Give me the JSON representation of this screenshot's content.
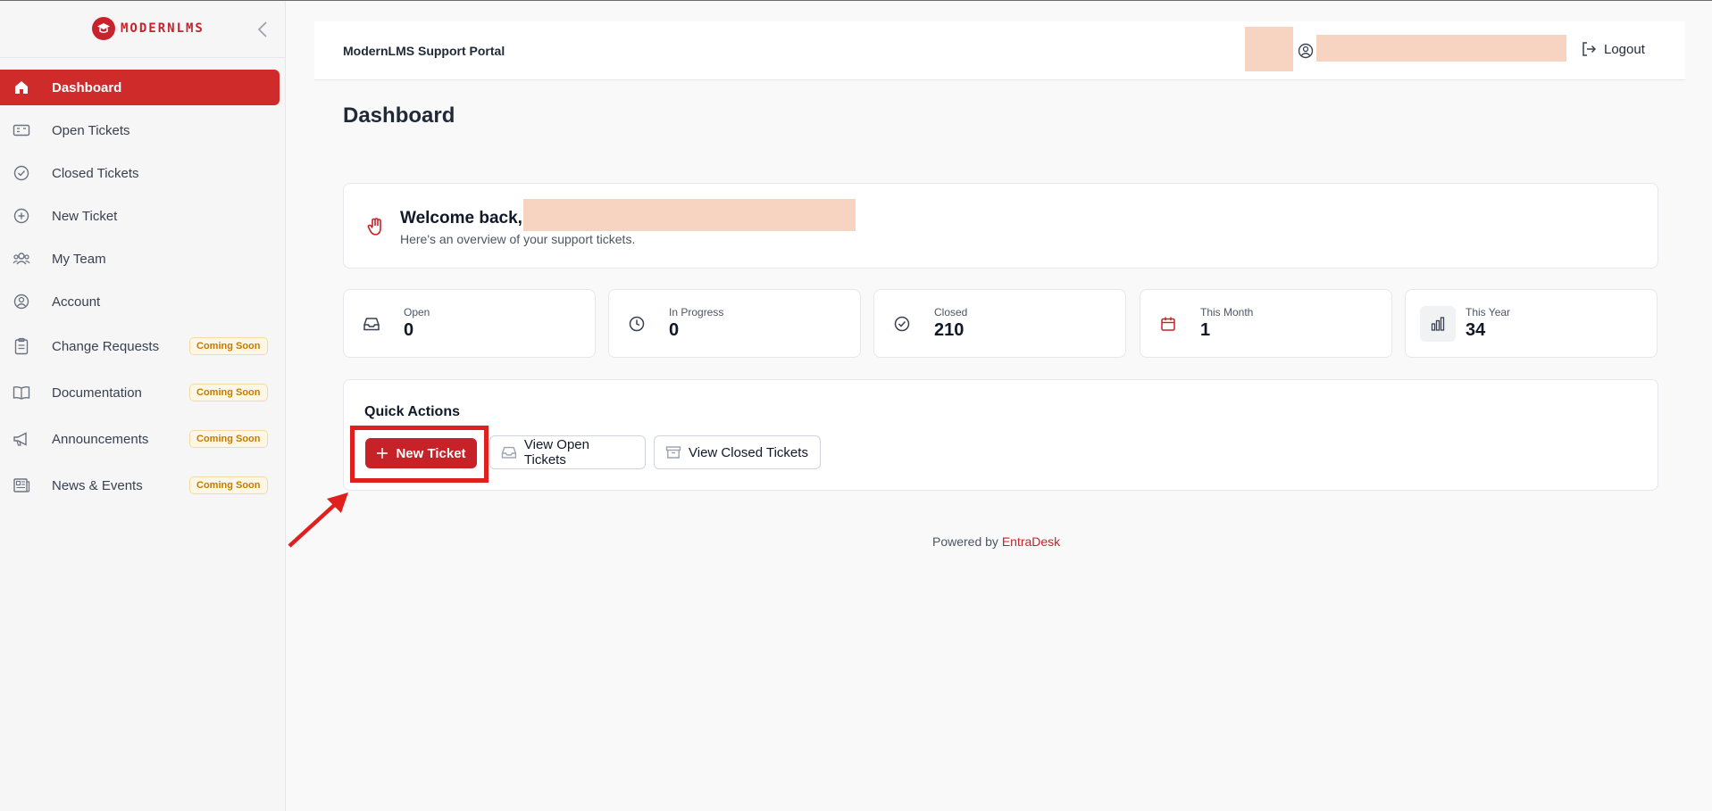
{
  "app": {
    "logo_text": "MODERNLMS",
    "portal_title": "ModernLMS Support Portal"
  },
  "header": {
    "logout_label": "Logout"
  },
  "sidebar": {
    "items": [
      {
        "label": "Dashboard",
        "icon": "home-icon",
        "active": true
      },
      {
        "label": "Open Tickets",
        "icon": "ticket-icon"
      },
      {
        "label": "Closed Tickets",
        "icon": "check-circle-icon"
      },
      {
        "label": "New Ticket",
        "icon": "plus-circle-icon"
      },
      {
        "label": "My Team",
        "icon": "team-icon"
      },
      {
        "label": "Account",
        "icon": "user-circle-icon"
      },
      {
        "label": "Change Requests",
        "icon": "clipboard-icon",
        "badge": "Coming Soon"
      },
      {
        "label": "Documentation",
        "icon": "book-icon",
        "badge": "Coming Soon"
      },
      {
        "label": "Announcements",
        "icon": "megaphone-icon",
        "badge": "Coming Soon"
      },
      {
        "label": "News & Events",
        "icon": "newspaper-icon",
        "badge": "Coming Soon"
      }
    ]
  },
  "main": {
    "page_title": "Dashboard",
    "welcome": {
      "greeting": "Welcome back,",
      "subtitle": "Here's an overview of your support tickets."
    },
    "stats": [
      {
        "label": "Open",
        "value": "0",
        "icon": "inbox-icon"
      },
      {
        "label": "In Progress",
        "value": "0",
        "icon": "clock-icon"
      },
      {
        "label": "Closed",
        "value": "210",
        "icon": "check-circle-icon"
      },
      {
        "label": "This Month",
        "value": "1",
        "icon": "calendar-icon"
      },
      {
        "label": "This Year",
        "value": "34",
        "icon": "bar-chart-icon"
      }
    ],
    "quick_actions": {
      "title": "Quick Actions",
      "new_ticket": "New Ticket",
      "view_open": "View Open Tickets",
      "view_closed": "View Closed Tickets"
    }
  },
  "footer": {
    "powered_by": "Powered by",
    "brand": "EntraDesk"
  },
  "colors": {
    "accent": "#d02b2b",
    "badge_text": "#c47a00",
    "redaction": "#f7d4c1",
    "annotation": "#e0201f"
  }
}
